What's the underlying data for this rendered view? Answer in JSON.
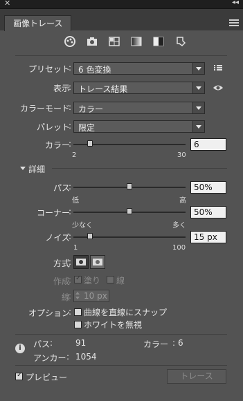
{
  "panel": {
    "tab_label": "画像トレース"
  },
  "preset": {
    "label": "プリセット",
    "value": "6 色変換"
  },
  "view": {
    "label": "表示",
    "value": "トレース結果"
  },
  "color_mode": {
    "label": "カラーモード",
    "value": "カラー"
  },
  "palette": {
    "label": "パレット",
    "value": "限定"
  },
  "colors": {
    "label": "カラー",
    "value": "6",
    "min": "2",
    "max": "30",
    "fraction": 0.15
  },
  "details": {
    "label": "詳細"
  },
  "paths": {
    "label": "パス",
    "value": "50%",
    "min": "低",
    "max": "高",
    "fraction": 0.5
  },
  "corners": {
    "label": "コーナー",
    "value": "50%",
    "min": "少なく",
    "max": "多く",
    "fraction": 0.5
  },
  "noise": {
    "label": "ノイズ",
    "value": "15 px",
    "min": "1",
    "max": "100",
    "fraction": 0.15
  },
  "method": {
    "label": "方式"
  },
  "create": {
    "label": "作成",
    "fill": "塗り",
    "stroke": "線"
  },
  "stroke": {
    "label": "線",
    "value": "10 px"
  },
  "options": {
    "label": "オプション",
    "snap": "曲線を直線にスナップ",
    "ignore_white": "ホワイトを無視"
  },
  "stats": {
    "paths_label": "パス",
    "paths_value": "91",
    "colors_label": "カラー",
    "colors_value": "6",
    "anchors_label": "アンカー",
    "anchors_value": "1054"
  },
  "footer": {
    "preview_label": "プレビュー",
    "trace_button": "トレース"
  }
}
